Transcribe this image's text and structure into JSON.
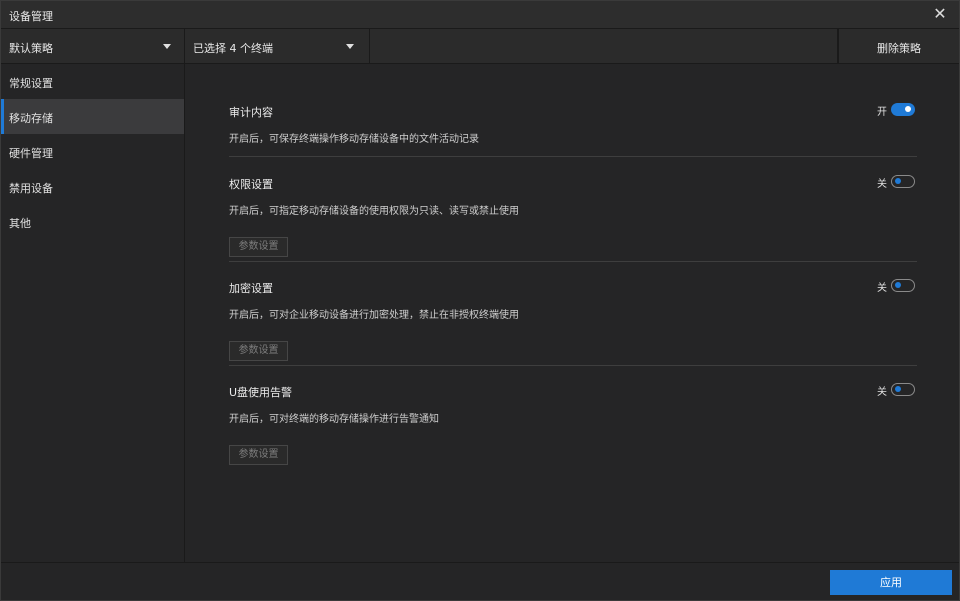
{
  "window": {
    "title": "设备管理",
    "close_icon": "close-icon"
  },
  "toolbar": {
    "policy_select": "默认策略",
    "terminal_select": "已选择 4 个终端",
    "delete_label": "删除策略"
  },
  "sidebar": {
    "items": [
      {
        "label": "常规设置",
        "active": false
      },
      {
        "label": "移动存储",
        "active": true
      },
      {
        "label": "硬件管理",
        "active": false
      },
      {
        "label": "禁用设备",
        "active": false
      },
      {
        "label": "其他",
        "active": false
      }
    ]
  },
  "sections": [
    {
      "title": "审计内容",
      "description": "开启后，可保存终端操作移动存储设备中的文件活动记录",
      "toggle_label": "开",
      "enabled": true
    },
    {
      "title": "权限设置",
      "description": "开启后，可指定移动存储设备的使用权限为只读、读写或禁止使用",
      "toggle_label": "关",
      "enabled": false,
      "button_label": "参数设置"
    },
    {
      "title": "加密设置",
      "description": "开启后，可对企业移动设备进行加密处理，禁止在非授权终端使用",
      "toggle_label": "关",
      "enabled": false,
      "button_label": "参数设置"
    },
    {
      "title": "U盘使用告警",
      "description": "开启后，可对终端的移动存储操作进行告警通知",
      "toggle_label": "关",
      "enabled": false,
      "button_label": "参数设置"
    }
  ],
  "footer": {
    "apply_label": "应用"
  },
  "colors": {
    "accent": "#1f7ad6",
    "background": "#252526"
  }
}
